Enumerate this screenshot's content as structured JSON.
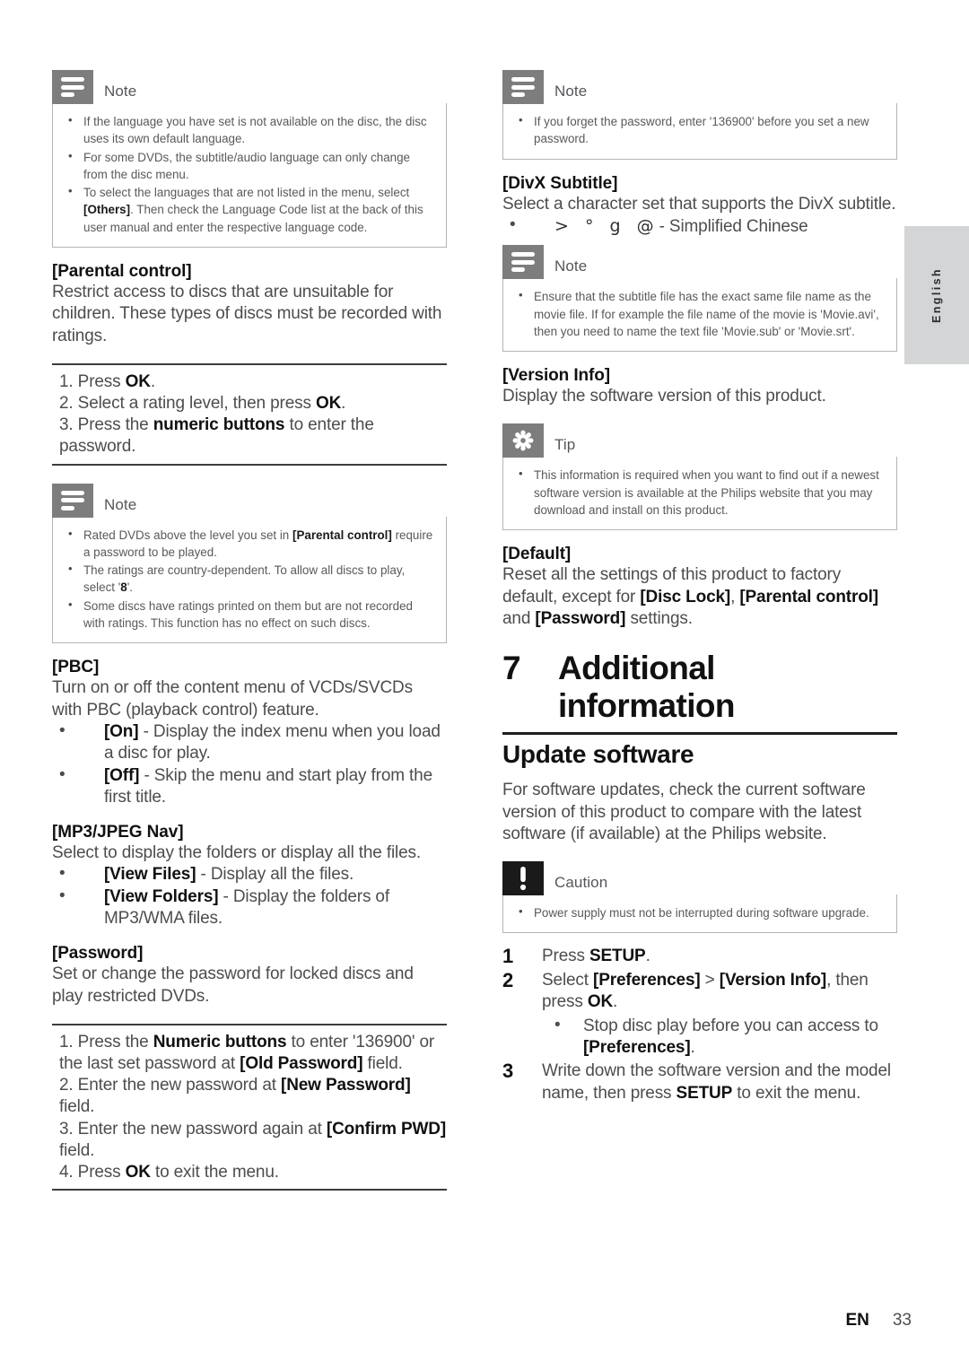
{
  "page": {
    "language_tab": "English",
    "footer_locale": "EN",
    "footer_page_number": "33"
  },
  "left_column": {
    "note_language": {
      "icon": "note-icon",
      "title": "Note",
      "items": [
        "If the language you have set is not available on the disc, the disc uses its own default language.",
        "For some DVDs, the subtitle/audio language can only change from the disc menu.",
        "To select the languages that are not listed in the menu, select [Others]. Then check the Language Code list at the back of this user manual and enter the respective language code."
      ],
      "bold_terms": [
        "[Others]"
      ]
    },
    "parental_control": {
      "heading": "[Parental control]",
      "body": "Restrict access to discs that are unsuitable for children. These types of discs must be recorded with ratings.",
      "steps": [
        "1. Press OK.",
        "2. Select a rating level, then press OK.",
        "3. Press the numeric buttons to enter the password."
      ]
    },
    "note_ratings": {
      "icon": "note-icon",
      "title": "Note",
      "items": [
        "Rated DVDs above the level you set in [Parental control] require a password to be played.",
        "The ratings are country-dependent. To allow all discs to play, select '8'.",
        "Some discs have ratings printed on them but are not recorded with ratings. This function has no effect on such discs."
      ]
    },
    "pbc": {
      "heading": "[PBC]",
      "body": "Turn on or off the content menu of VCDs/SVCDs with PBC (playback control) feature.",
      "options": [
        {
          "label": "[On]",
          "text": " - Display the index menu when you load a disc for play."
        },
        {
          "label": "[Off]",
          "text": " - Skip the menu and start play from the first title."
        }
      ]
    },
    "mp3_jpeg_nav": {
      "heading": "[MP3/JPEG Nav]",
      "body": "Select to display the folders or display all the files.",
      "options": [
        {
          "label": "[View Files]",
          "text": " - Display all the files."
        },
        {
          "label": "[View Folders]",
          "text": " - Display the folders of MP3/WMA files."
        }
      ]
    },
    "password": {
      "heading": "[Password]",
      "body": "Set or change the password for locked discs and play restricted DVDs.",
      "steps": [
        "1. Press the Numeric buttons to enter '136900' or the last set password at [Old Password] field.",
        "2. Enter the new password at [New Password] field.",
        "3. Enter the new password again at [Confirm PWD] field.",
        "4. Press OK to exit the menu."
      ]
    }
  },
  "right_column": {
    "note_forgot_password": {
      "icon": "note-icon",
      "title": "Note",
      "items": [
        "If you forget the password, enter '136900' before you set a new password."
      ]
    },
    "divx_subtitle": {
      "heading": "[DivX Subtitle]",
      "body": "Select a character set that supports the DivX subtitle.",
      "options": [
        {
          "label": "> °  g  @",
          "text": "- Simplified Chinese"
        }
      ]
    },
    "note_subtitle_file": {
      "icon": "note-icon",
      "title": "Note",
      "items": [
        "Ensure that the subtitle file has the exact same file name as the movie file. If for example the file name of the movie is 'Movie.avi', then you need to name the text file 'Movie.sub' or 'Movie.srt'."
      ]
    },
    "version_info": {
      "heading": "[Version Info]",
      "body": "Display the software version of this product."
    },
    "tip_version": {
      "icon": "tip-star-icon",
      "title": "Tip",
      "items": [
        "This information is required when you want to find out if a newest software version is available at the Philips website that you may download and install on this product."
      ]
    },
    "default_settings": {
      "heading": "[Default]",
      "body": "Reset all the settings of this product to factory default, except for [Disc Lock], [Parental control] and [Password] settings."
    },
    "chapter": {
      "number": "7",
      "title": "Additional information"
    },
    "update_software": {
      "heading": "Update software",
      "body": "For software updates, check the current software version of this product to compare with the latest software (if available) at the Philips website."
    },
    "caution_power": {
      "icon": "caution-exclamation-icon",
      "title": "Caution",
      "items": [
        "Power supply must not be interrupted during software upgrade."
      ]
    },
    "update_steps": [
      {
        "number": "1",
        "text": "Press SETUP."
      },
      {
        "number": "2",
        "text": "Select [Preferences] > [Version Info], then press OK.",
        "substep": "Stop disc play before you can access to [Preferences]."
      },
      {
        "number": "3",
        "text": "Write down the software version and the model name, then press SETUP to exit the menu."
      }
    ]
  }
}
